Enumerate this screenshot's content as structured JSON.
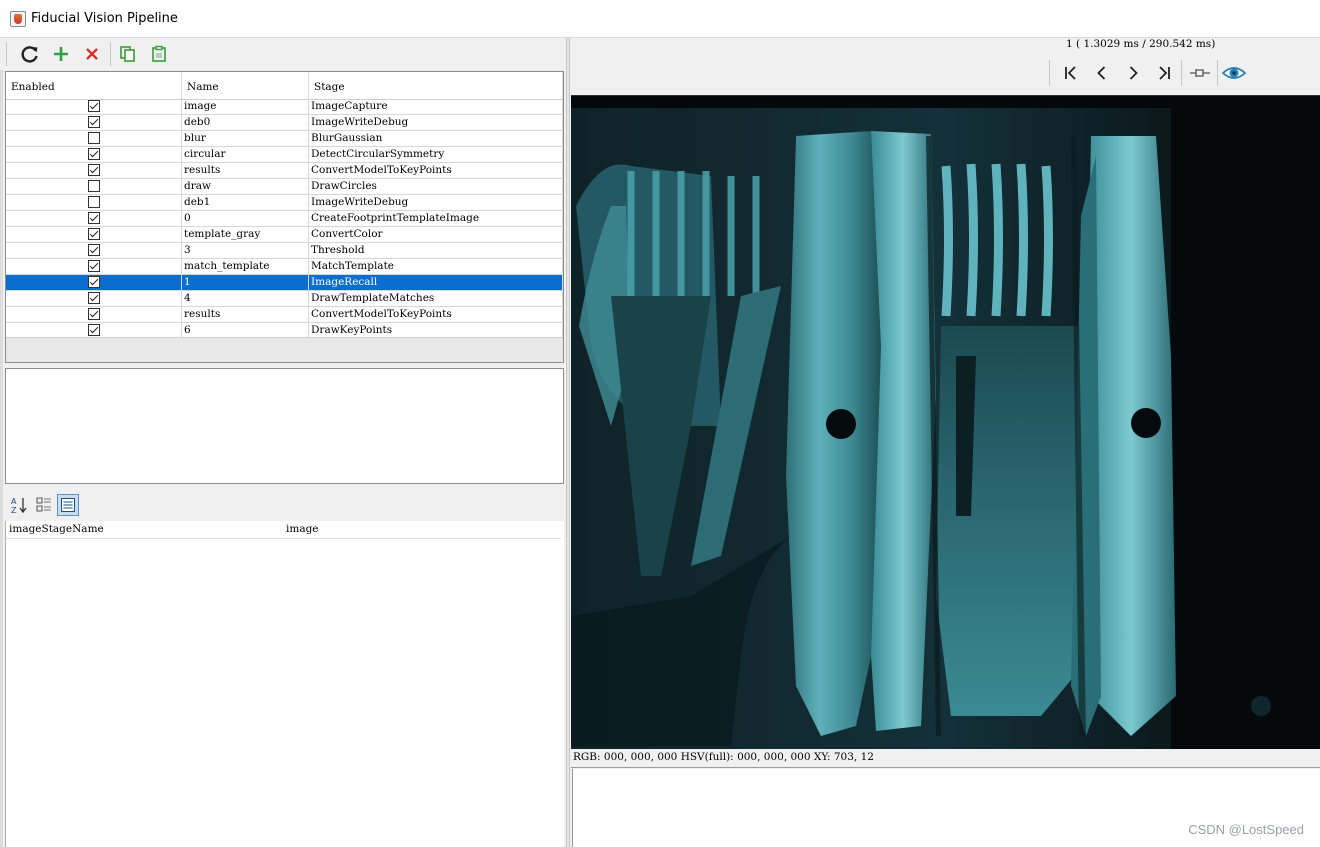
{
  "window": {
    "title": "Fiducial Vision Pipeline"
  },
  "toolbar": {
    "buttons": [
      {
        "name": "refresh",
        "icon": "refresh-icon"
      },
      {
        "name": "add",
        "icon": "plus-icon",
        "color": "#2ea043"
      },
      {
        "name": "remove",
        "icon": "x-icon",
        "color": "#d32f2f"
      },
      {
        "name": "copy",
        "icon": "copy-icon",
        "color": "#3c9a3c"
      },
      {
        "name": "paste",
        "icon": "clipboard-icon",
        "color": "#3c9a3c"
      }
    ]
  },
  "table": {
    "columns": [
      "Enabled",
      "Name",
      "Stage"
    ],
    "rows": [
      {
        "enabled": true,
        "name": "image",
        "stage": "ImageCapture"
      },
      {
        "enabled": true,
        "name": "deb0",
        "stage": "ImageWriteDebug"
      },
      {
        "enabled": false,
        "name": "blur",
        "stage": "BlurGaussian"
      },
      {
        "enabled": true,
        "name": "circular",
        "stage": "DetectCircularSymmetry"
      },
      {
        "enabled": true,
        "name": "results",
        "stage": "ConvertModelToKeyPoints"
      },
      {
        "enabled": false,
        "name": "draw",
        "stage": "DrawCircles"
      },
      {
        "enabled": false,
        "name": "deb1",
        "stage": "ImageWriteDebug"
      },
      {
        "enabled": true,
        "name": "0",
        "stage": "CreateFootprintTemplateImage"
      },
      {
        "enabled": true,
        "name": "template_gray",
        "stage": "ConvertColor"
      },
      {
        "enabled": true,
        "name": "3",
        "stage": "Threshold"
      },
      {
        "enabled": true,
        "name": "match_template",
        "stage": "MatchTemplate"
      },
      {
        "enabled": true,
        "name": "1",
        "stage": "ImageRecall",
        "selected": true
      },
      {
        "enabled": true,
        "name": "4",
        "stage": "DrawTemplateMatches"
      },
      {
        "enabled": true,
        "name": "results",
        "stage": "ConvertModelToKeyPoints"
      },
      {
        "enabled": true,
        "name": "6",
        "stage": "DrawKeyPoints"
      }
    ],
    "selected_color": "#0a6ed1"
  },
  "properties": {
    "rows": [
      {
        "key": "imageStageName",
        "value": "image"
      }
    ]
  },
  "viewer": {
    "timing": "1 ( 1.3029 ms / 290.542 ms)",
    "nav": [
      "first-icon",
      "prev-icon",
      "next-icon",
      "last-icon",
      "pin-icon",
      "eye-icon"
    ],
    "status": "RGB: 000, 000, 000 HSV(full): 000, 000, 000 XY: 703, 12",
    "accent": "#2a7fb5"
  },
  "watermark": "CSDN @LostSpeed"
}
